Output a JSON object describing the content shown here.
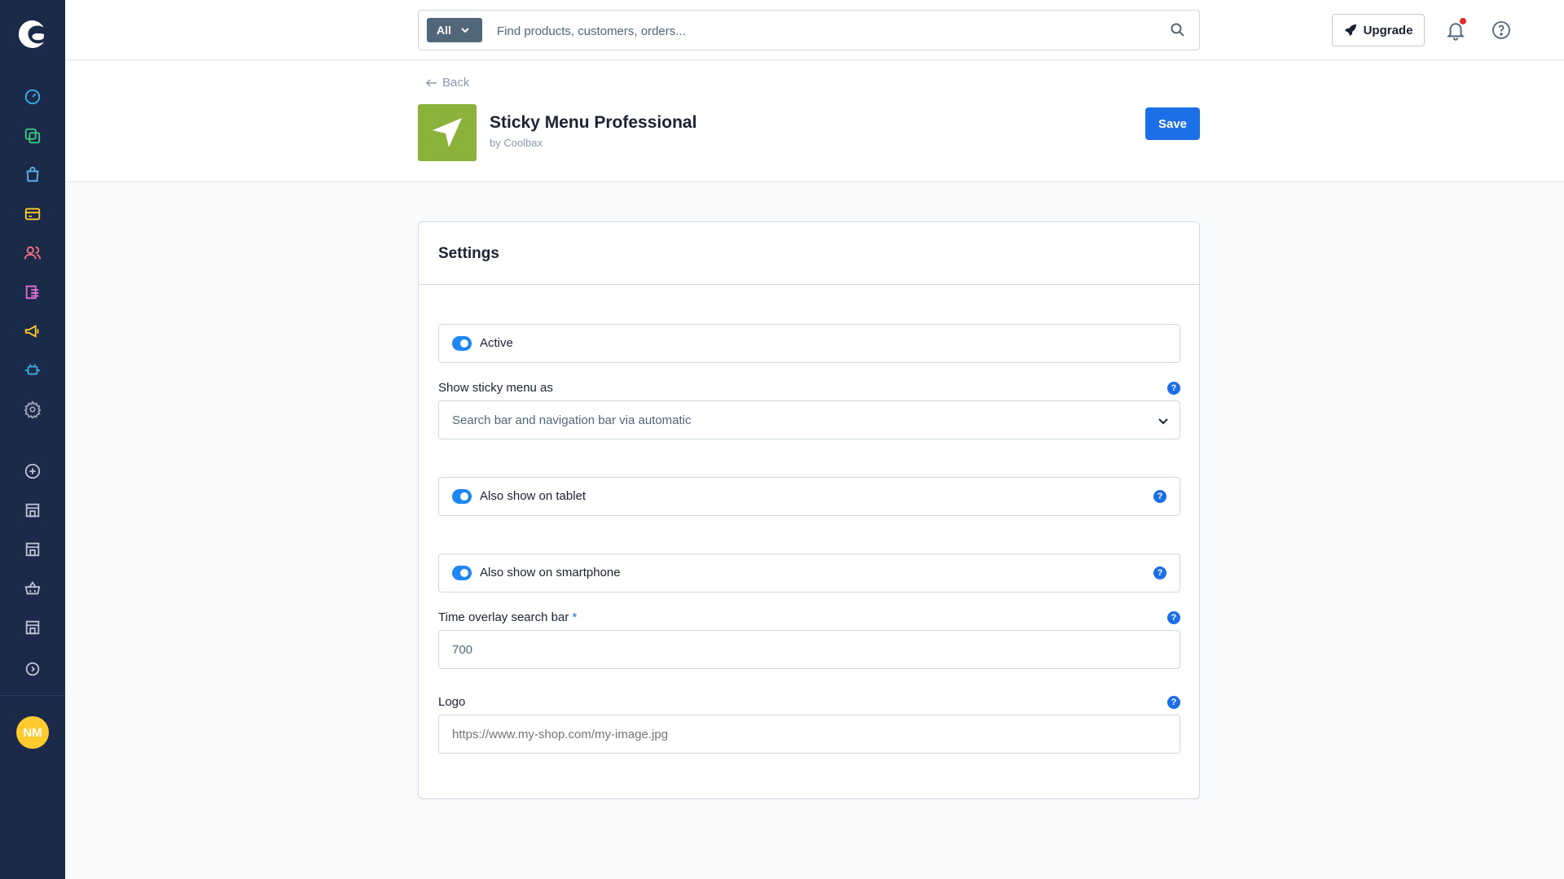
{
  "search": {
    "scope_label": "All",
    "placeholder": "Find products, customers, orders..."
  },
  "header": {
    "upgrade_label": "Upgrade"
  },
  "user": {
    "initials": "NM"
  },
  "page": {
    "back_label": "Back",
    "app_title": "Sticky Menu Professional",
    "app_by": "by Coolbax",
    "save_label": "Save",
    "app_icon_color": "#8bb33c"
  },
  "settings": {
    "title": "Settings",
    "active_label": "Active",
    "active_on": true,
    "sticky_menu_label": "Show sticky menu as",
    "sticky_menu_value": "Search bar and navigation bar via automatic",
    "tablet_label": "Also show on tablet",
    "tablet_on": true,
    "smartphone_label": "Also show on smartphone",
    "smartphone_on": true,
    "time_overlay_label": "Time overlay search bar",
    "time_overlay_required": "*",
    "time_overlay_value": "700",
    "logo_label": "Logo",
    "logo_placeholder": "https://www.my-shop.com/my-image.jpg",
    "help_glyph": "?"
  },
  "colors": {
    "sidebar": "#1b2a48",
    "primary": "#1d6fe8",
    "toggle_on": "#1d86f0",
    "avatar": "#ffcb2f"
  },
  "sidebar_icons": [
    "dashboard-icon",
    "catalogues-icon",
    "orders-icon",
    "payments-icon",
    "customers-icon",
    "content-icon",
    "marketing-icon",
    "extensions-icon",
    "settings-icon",
    "add-sales-channel-icon",
    "sales-channel-store-icon",
    "sales-channel-store-icon",
    "sales-channel-basket-icon",
    "sales-channel-store-icon",
    "collapse-sidebar-icon"
  ]
}
